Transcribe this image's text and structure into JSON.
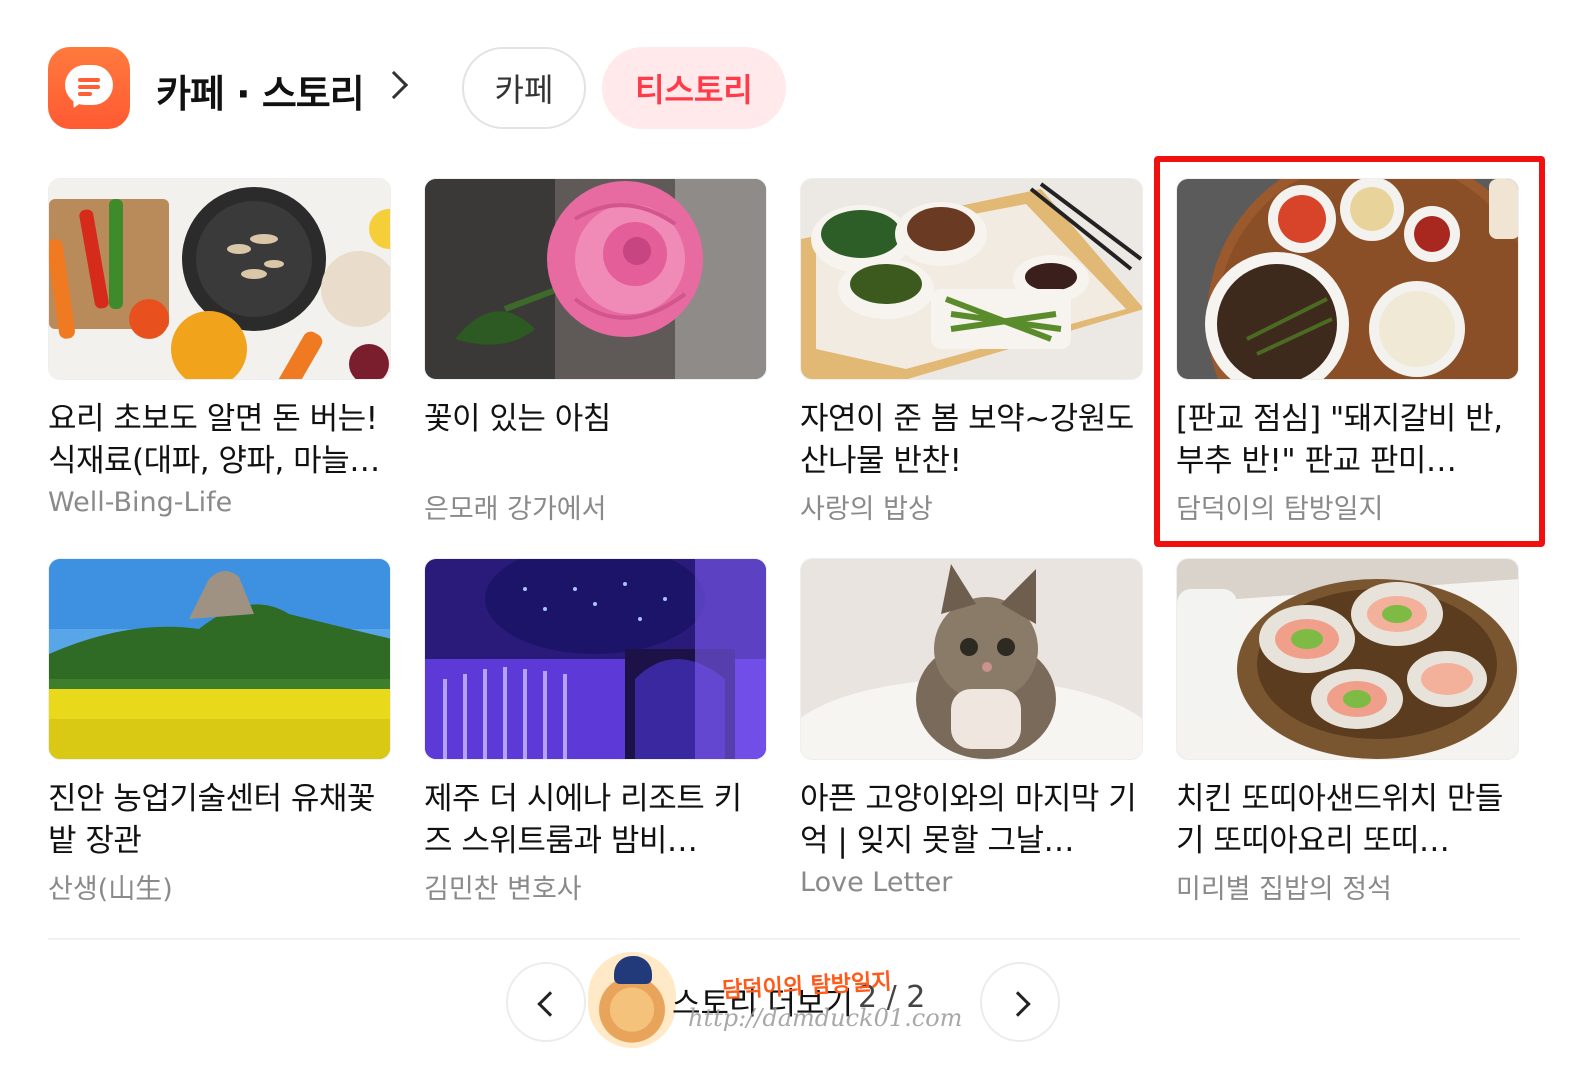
{
  "header": {
    "section_title": "카페 · 스토리",
    "tabs": [
      {
        "label": "카페",
        "active": false
      },
      {
        "label": "티스토리",
        "active": true
      }
    ],
    "accent_color": "#ff5a33",
    "active_tab_color": "#ff3b4a"
  },
  "cards": [
    {
      "title": "요리 초보도 알면 돈 버는! 식재료(대파, 양파, 마늘…",
      "blog": "Well-Bing-Life",
      "image": "cooking-ingredients-photo"
    },
    {
      "title": "꽃이 있는 아침",
      "blog": "은모래 강가에서",
      "image": "pink-rose-photo"
    },
    {
      "title": "자연이 준 봄 보약~강원도 산나물 반찬!",
      "blog": "사랑의 밥상",
      "image": "wild-greens-side-dishes-photo"
    },
    {
      "title": "[판교 점심] \"돼지갈비 반, 부추 반!\" 판교 판미…",
      "blog": "담덕이의 탐방일지",
      "image": "pork-galbi-lunch-photo",
      "highlighted": true
    },
    {
      "title": "진안 농업기술센터 유채꽃밭 장관",
      "blog": "산생(山生)",
      "image": "canola-field-mountain-photo"
    },
    {
      "title": "제주 더 시에나 리조트 키즈 스위트룸과 밤비…",
      "blog": "김민찬 변호사",
      "image": "purple-kids-room-photo"
    },
    {
      "title": "아픈 고양이와의 마지막 기억 | 잊지 못할 그날…",
      "blog": "Love Letter",
      "image": "tabby-kitten-photo"
    },
    {
      "title": "치킨 또띠아샌드위치 만들기 또띠아요리 또띠…",
      "blog": "미리별 집밥의 정석",
      "image": "tortilla-wraps-photo"
    }
  ],
  "footer": {
    "more_label": "스토리 더보기",
    "page_current": "2",
    "page_total": "2",
    "page_text": "2 / 2"
  },
  "watermark": {
    "title": "담덕이의 탐방일지",
    "url": "http://damduck01.com"
  }
}
